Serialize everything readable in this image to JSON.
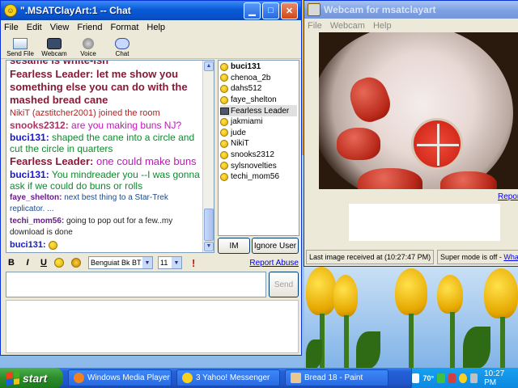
{
  "chat_window": {
    "title": "\".MSATClayArt:1 -- Chat",
    "menu": [
      "File",
      "Edit",
      "View",
      "Friend",
      "Format",
      "Help"
    ],
    "toolbar": [
      {
        "label": "Send File",
        "icon": "send-file-icon"
      },
      {
        "label": "Webcam",
        "icon": "webcam-icon"
      },
      {
        "label": "Voice",
        "icon": "voice-icon"
      },
      {
        "label": "Chat",
        "icon": "chat-icon"
      }
    ],
    "messages": [
      {
        "name": "",
        "text": "sesame is white-ish",
        "style": "c-fl-t big partial"
      },
      {
        "name": "Fearless Leader:",
        "text": "let me show you something else you can do with the mashed bread cane",
        "style": "fl-big"
      },
      {
        "name": "",
        "text": "NikiT (azstitcher2001) joined the room",
        "style": "join"
      },
      {
        "name": "snooks2312:",
        "text": "are you making buns NJ?",
        "style": "snooks"
      },
      {
        "name": "buci131:",
        "text": "shaped the cane into a circle and cut the circle in quarters",
        "style": "buci"
      },
      {
        "name": "Fearless Leader:",
        "text": "one could make buns",
        "style": "fl-mag"
      },
      {
        "name": "buci131:",
        "text": "You mindreader you --I was gonna ask if we could do buns or rolls",
        "style": "buci"
      },
      {
        "name": "faye_shelton:",
        "text": "next best thing to a Star-Trek replicator. ...",
        "style": "faye"
      },
      {
        "name": "techi_mom56:",
        "text": "going to pop out for a few..my download is done",
        "style": "techi"
      },
      {
        "name": "buci131:",
        "text": "",
        "style": "buci-smiley"
      }
    ],
    "users": [
      {
        "name": "buci131",
        "icon": "smiley-icon",
        "bold": true,
        "selected": false
      },
      {
        "name": "chenoa_2b",
        "icon": "smiley-icon",
        "bold": false,
        "selected": false
      },
      {
        "name": "dahs512",
        "icon": "smiley-icon",
        "bold": false,
        "selected": false
      },
      {
        "name": "faye_shelton",
        "icon": "smiley-icon",
        "bold": false,
        "selected": false
      },
      {
        "name": "Fearless Leader",
        "icon": "webcam-user-icon",
        "bold": false,
        "selected": true
      },
      {
        "name": "jakmiami",
        "icon": "smiley-icon",
        "bold": false,
        "selected": false
      },
      {
        "name": "jude",
        "icon": "smiley-icon",
        "bold": false,
        "selected": false
      },
      {
        "name": "NikiT",
        "icon": "smiley-icon",
        "bold": false,
        "selected": false
      },
      {
        "name": "snooks2312",
        "icon": "smiley-icon",
        "bold": false,
        "selected": false
      },
      {
        "name": "sylsnovelties",
        "icon": "smiley-icon",
        "bold": false,
        "selected": false
      },
      {
        "name": "techi_mom56",
        "icon": "smiley-icon",
        "bold": false,
        "selected": false
      }
    ],
    "im_label": "IM",
    "ignore_label": "Ignore User",
    "format": {
      "bold": "B",
      "italic": "I",
      "underline": "U",
      "font": "Benguiat Bk BT",
      "size": "11"
    },
    "report_abuse": "Report Abuse",
    "send_label": "Send",
    "input_value": ""
  },
  "webcam_window": {
    "title": "Webcam for msatclayart",
    "menu": [
      "File",
      "Webcam",
      "Help"
    ],
    "report_link": "Report",
    "last_image": "Last image received at (10:27:47 PM)",
    "super_mode": "Super mode is off -",
    "super_mode_link": "What"
  },
  "taskbar": {
    "start": "start",
    "tasks": [
      {
        "label": "Windows Media Player",
        "icon": "media-player-icon",
        "active": false
      },
      {
        "label": "3 Yahoo! Messenger",
        "icon": "messenger-icon",
        "active": false
      },
      {
        "label": "Bread 18 - Paint",
        "icon": "paint-icon",
        "active": false
      }
    ],
    "tray_temp": "70°",
    "clock": "10:27 PM"
  },
  "colors": {
    "xp_blue": "#0a5ad8",
    "start_green": "#2c8c2c",
    "link": "#0000ee"
  }
}
